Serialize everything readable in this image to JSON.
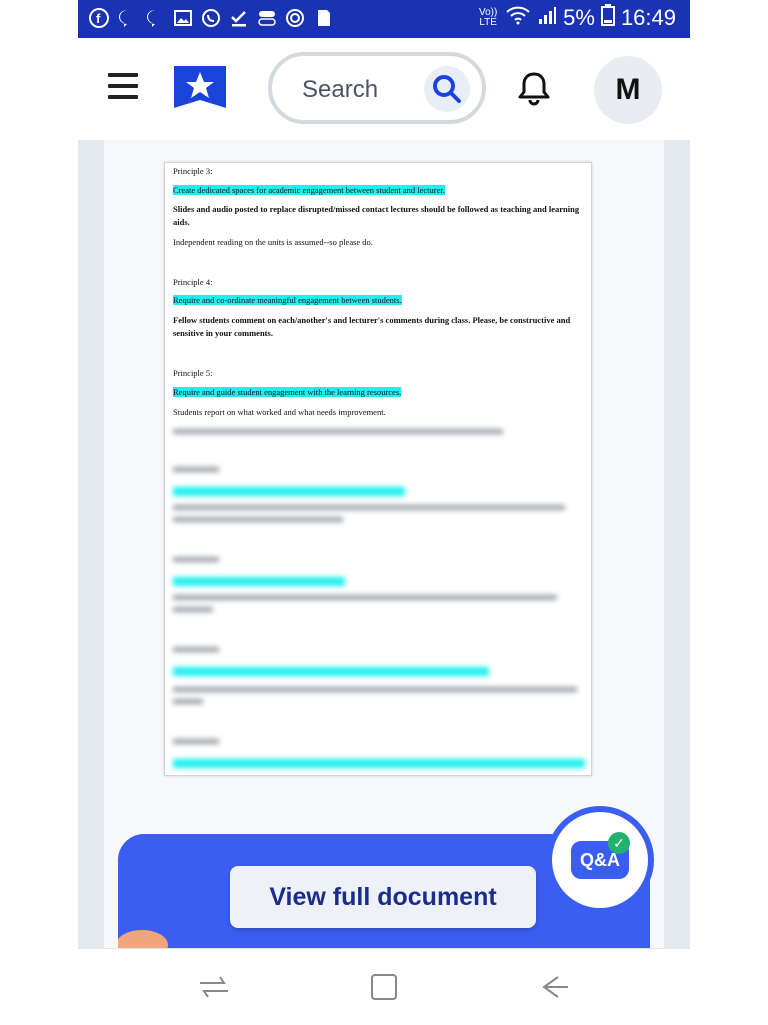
{
  "status_bar": {
    "time": "16:49",
    "battery": "5%",
    "network_label": "Vo)) LTE",
    "left_icons": [
      "facebook-icon",
      "messenger-icon",
      "messenger-icon",
      "image-icon",
      "whatsapp-icon",
      "download-done-icon",
      "toggle-icon",
      "camera-lens-icon",
      "sd-card-icon"
    ],
    "bg_color": "#1a33b5"
  },
  "header": {
    "search_placeholder": "Search",
    "avatar_initial": "M",
    "brand_color": "#1a44d8"
  },
  "document": {
    "paragraphs": [
      {
        "text": "Principle 3:",
        "style": "normal"
      },
      {
        "text": "Create dedicated spaces for academic engagement between student and lecturer.",
        "style": "highlight"
      },
      {
        "text": "Slides and audio posted to replace disrupted/missed contact lectures should be followed as teaching and learning aids.",
        "style": "bold"
      },
      {
        "text": "Independent reading on the units is assumed--so please do.",
        "style": "normal"
      },
      {
        "text": "Principle 4:",
        "style": "normal"
      },
      {
        "text": "Require and co-ordinate meaningful engagement between students.",
        "style": "highlight"
      },
      {
        "text": "Fellow students comment on each/another's and lecturer's comments during class. Please, be constructive and sensitive in your comments.",
        "style": "bold"
      },
      {
        "text": "Principle 5:",
        "style": "normal"
      },
      {
        "text": "Require and guide student engagement with the learning resources.",
        "style": "highlight"
      },
      {
        "text": "Students report on what worked and what needs improvement.",
        "style": "normal"
      }
    ]
  },
  "cta": {
    "view_full_label": "View full document",
    "qa_label": "Q&A"
  }
}
